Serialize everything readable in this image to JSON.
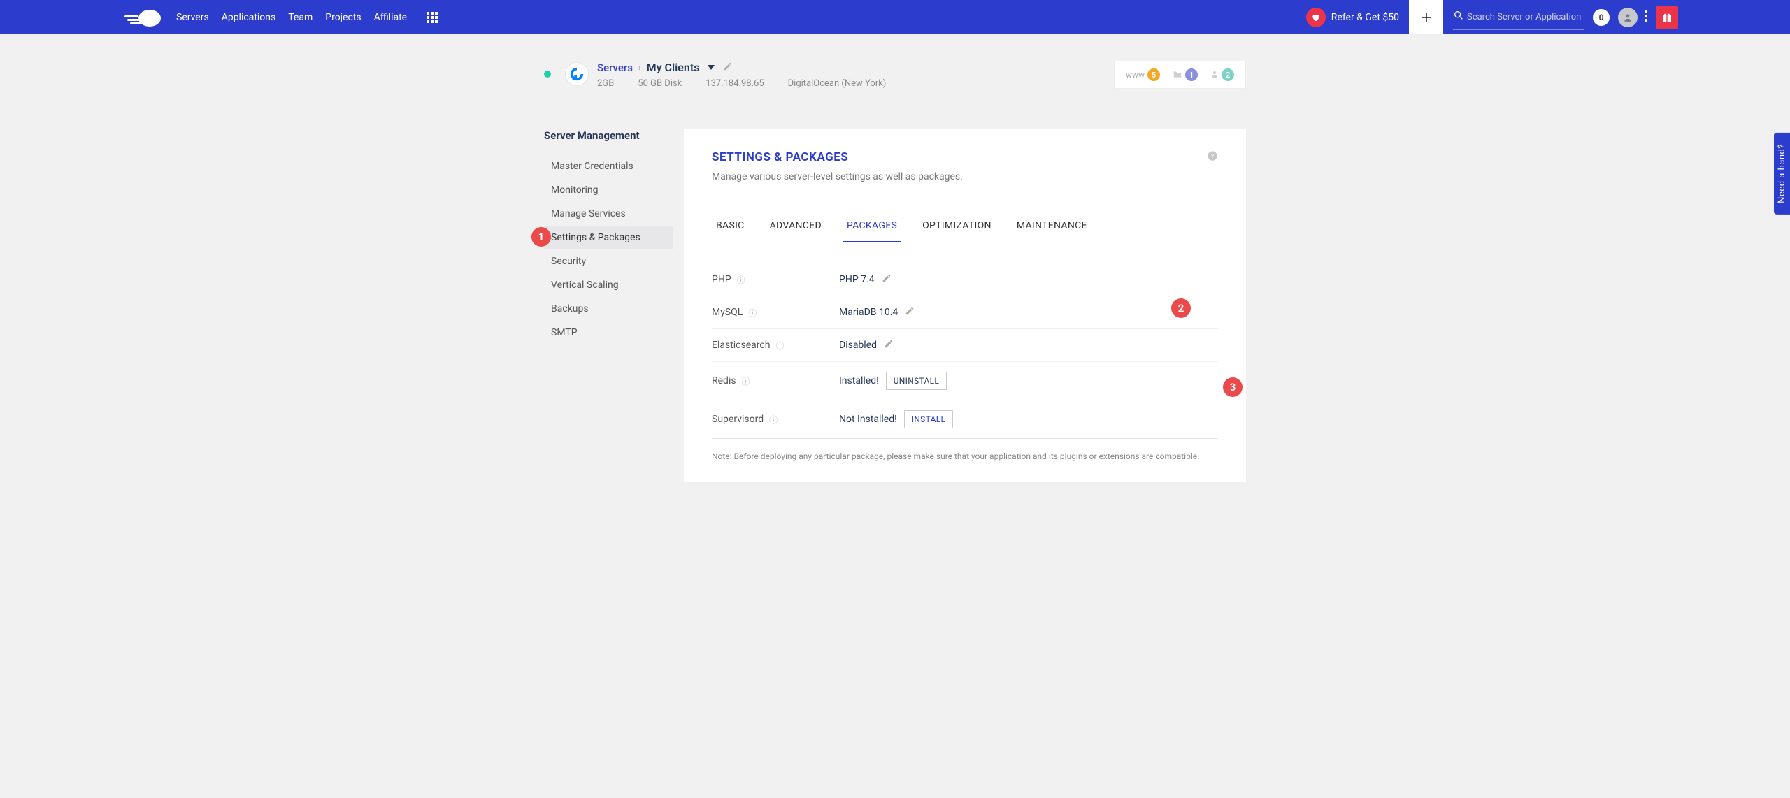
{
  "topbar": {
    "nav": [
      "Servers",
      "Applications",
      "Team",
      "Projects",
      "Affiliate"
    ],
    "refer_label": "Refer & Get $50",
    "search_placeholder": "Search Server or Application",
    "notif_count": "0"
  },
  "server_header": {
    "breadcrumb_root": "Servers",
    "server_name": "My Clients",
    "specs": {
      "ram": "2GB",
      "disk": "50 GB Disk",
      "ip": "137.184.98.65",
      "provider_region": "DigitalOcean (New York)"
    },
    "badges": {
      "www": {
        "label": "www",
        "count": "5"
      },
      "projects": {
        "count": "1"
      },
      "team": {
        "count": "2"
      }
    }
  },
  "sidebar": {
    "title": "Server Management",
    "items": [
      "Master Credentials",
      "Monitoring",
      "Manage Services",
      "Settings & Packages",
      "Security",
      "Vertical Scaling",
      "Backups",
      "SMTP"
    ],
    "active_index": 3
  },
  "panel": {
    "title": "SETTINGS & PACKAGES",
    "subtitle": "Manage various server-level settings as well as packages.",
    "tabs": [
      "BASIC",
      "ADVANCED",
      "PACKAGES",
      "OPTIMIZATION",
      "MAINTENANCE"
    ],
    "active_tab_index": 2,
    "packages": [
      {
        "label": "PHP",
        "value": "PHP 7.4",
        "edit": true
      },
      {
        "label": "MySQL",
        "value": "MariaDB 10.4",
        "edit": true
      },
      {
        "label": "Elasticsearch",
        "value": "Disabled",
        "edit": true
      },
      {
        "label": "Redis",
        "value": "Installed!",
        "button": "UNINSTALL"
      },
      {
        "label": "Supervisord",
        "value": "Not Installed!",
        "button": "INSTALL"
      }
    ],
    "note": "Note: Before deploying any particular package, please make sure that your application and its plugins or extensions are compatible."
  },
  "annotations": {
    "a1": "1",
    "a2": "2",
    "a3": "3"
  },
  "help_tab": "Need a hand?"
}
